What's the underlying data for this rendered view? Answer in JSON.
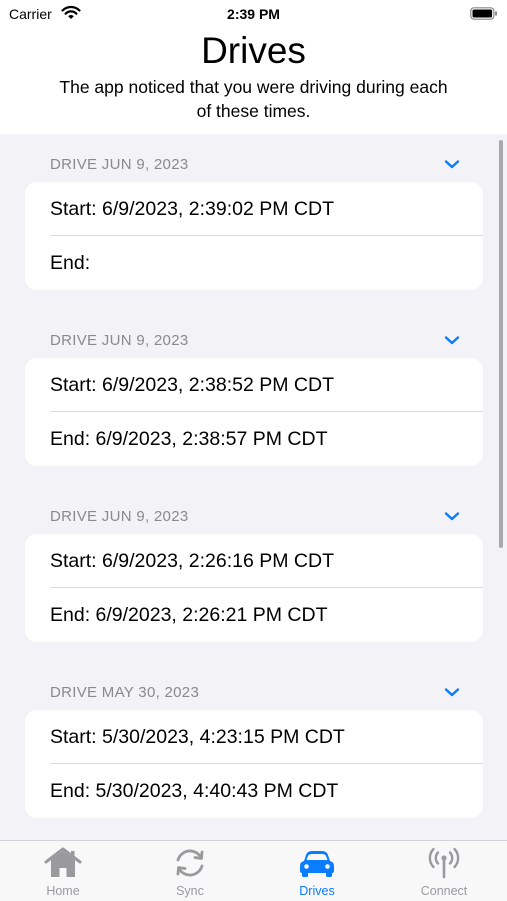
{
  "status_bar": {
    "carrier": "Carrier",
    "time": "2:39 PM"
  },
  "header": {
    "title": "Drives",
    "subtitle": "The app noticed that you were driving during each of these times."
  },
  "drives": [
    {
      "header": "DRIVE JUN 9, 2023",
      "start": "Start: 6/9/2023, 2:39:02 PM CDT",
      "end": "End:"
    },
    {
      "header": "DRIVE JUN 9, 2023",
      "start": "Start: 6/9/2023, 2:38:52 PM CDT",
      "end": "End: 6/9/2023, 2:38:57 PM CDT"
    },
    {
      "header": "DRIVE JUN 9, 2023",
      "start": "Start: 6/9/2023, 2:26:16 PM CDT",
      "end": "End: 6/9/2023, 2:26:21 PM CDT"
    },
    {
      "header": "DRIVE MAY 30, 2023",
      "start": "Start: 5/30/2023, 4:23:15 PM CDT",
      "end": "End: 5/30/2023, 4:40:43 PM CDT"
    }
  ],
  "tab_bar": {
    "tabs": [
      {
        "label": "Home",
        "icon": "house-icon"
      },
      {
        "label": "Sync",
        "icon": "sync-icon"
      },
      {
        "label": "Drives",
        "icon": "car-icon"
      },
      {
        "label": "Connect",
        "icon": "antenna-icon"
      }
    ],
    "active_tab": "Drives"
  },
  "colors": {
    "accent": "#0a7cff",
    "background": "#f2f2f7",
    "secondary_text": "#8a8a8e"
  }
}
